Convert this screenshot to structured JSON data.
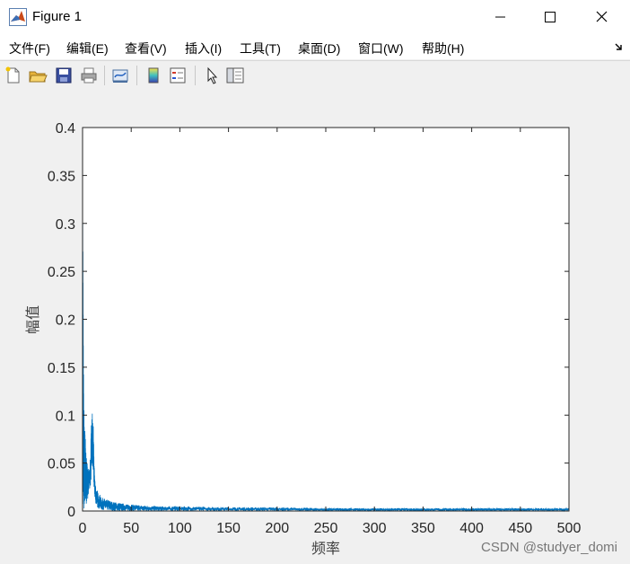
{
  "window": {
    "title": "Figure 1"
  },
  "menu": {
    "items": [
      {
        "label": "文件(F)"
      },
      {
        "label": "编辑(E)"
      },
      {
        "label": "查看(V)"
      },
      {
        "label": "插入(I)"
      },
      {
        "label": "工具(T)"
      },
      {
        "label": "桌面(D)"
      },
      {
        "label": "窗口(W)"
      },
      {
        "label": "帮助(H)"
      }
    ]
  },
  "toolbar": {
    "icons": [
      "new-figure-icon",
      "open-file-icon",
      "save-icon",
      "print-icon",
      "link-plot-icon",
      "colorbar-icon",
      "legend-icon",
      "pointer-icon",
      "property-inspector-icon"
    ]
  },
  "colors": {
    "line": "#0072BD",
    "axes_bg": "#ffffff",
    "figure_bg": "#f0f0f0"
  },
  "chart_data": {
    "type": "line",
    "title": "",
    "xlabel": "频率",
    "ylabel": "幅值",
    "xlim": [
      0,
      500
    ],
    "ylim": [
      0,
      0.4
    ],
    "xticks": [
      "0",
      "50",
      "100",
      "150",
      "200",
      "250",
      "300",
      "350",
      "400",
      "450",
      "500"
    ],
    "yticks": [
      "0",
      "0.05",
      "0.1",
      "0.15",
      "0.2",
      "0.25",
      "0.3",
      "0.35",
      "0.4"
    ],
    "grid": false,
    "series": [
      {
        "color": "#0072BD",
        "envelope": {
          "x": [
            0,
            0.3,
            0.6,
            1,
            1.5,
            2,
            3,
            4,
            5,
            6,
            7,
            8,
            9,
            10,
            11,
            12,
            13,
            14,
            15,
            17,
            20,
            25,
            30,
            35,
            40,
            50,
            60,
            80,
            100,
            150,
            200,
            250,
            300,
            350,
            400,
            450,
            500
          ],
          "upper": [
            0.36,
            0.3,
            0.22,
            0.15,
            0.11,
            0.095,
            0.075,
            0.055,
            0.05,
            0.045,
            0.048,
            0.06,
            0.09,
            0.105,
            0.09,
            0.05,
            0.03,
            0.024,
            0.022,
            0.018,
            0.014,
            0.012,
            0.01,
            0.009,
            0.008,
            0.007,
            0.006,
            0.005,
            0.005,
            0.004,
            0.004,
            0.003,
            0.003,
            0.003,
            0.003,
            0.003,
            0.003
          ],
          "lower": [
            0.0,
            0.0,
            0.0,
            0.0,
            0.0,
            0.0,
            0.005,
            0.006,
            0.012,
            0.015,
            0.018,
            0.025,
            0.035,
            0.04,
            0.035,
            0.02,
            0.01,
            0.006,
            0.004,
            0.002,
            0.001,
            0.001,
            0.0,
            0.0,
            0.0,
            0.0,
            0.0,
            0.0,
            0.0,
            0.0,
            0.0,
            0.0,
            0.0,
            0.0,
            0.0,
            0.0,
            0.0
          ]
        }
      }
    ]
  },
  "watermark": "CSDN @studyer_domi"
}
